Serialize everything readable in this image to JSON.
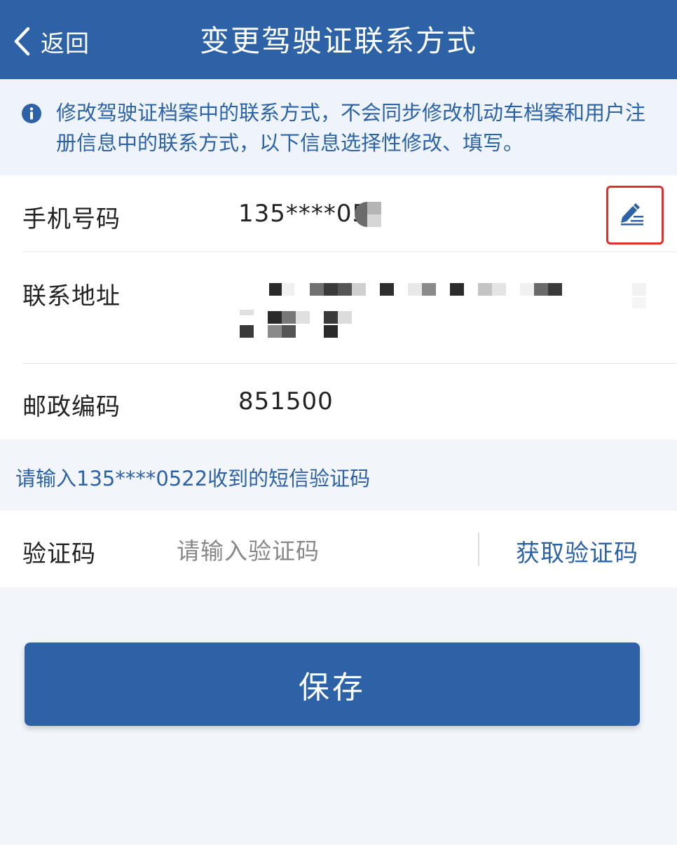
{
  "header": {
    "back_label": "返回",
    "title": "变更驾驶证联系方式"
  },
  "notice": {
    "text": "修改驾驶证档案中的联系方式，不会同步修改机动车档案和用户注册信息中的联系方式，以下信息选择性修改、填写。"
  },
  "form": {
    "phone": {
      "label": "手机号码",
      "value": "135****05"
    },
    "address": {
      "label": "联系地址"
    },
    "postal": {
      "label": "邮政编码",
      "value": "851500"
    }
  },
  "sms": {
    "hint": "请输入135****0522收到的短信验证码",
    "code_label": "验证码",
    "code_placeholder": "请输入验证码",
    "get_code_label": "获取验证码"
  },
  "save_label": "保存",
  "colors": {
    "primary": "#2d63a6",
    "background": "#f2f6fa",
    "highlight_box": "#e0302a"
  },
  "icons": {
    "back": "chevron-left-icon",
    "info": "info-circle-icon",
    "edit": "pen-edit-icon"
  }
}
